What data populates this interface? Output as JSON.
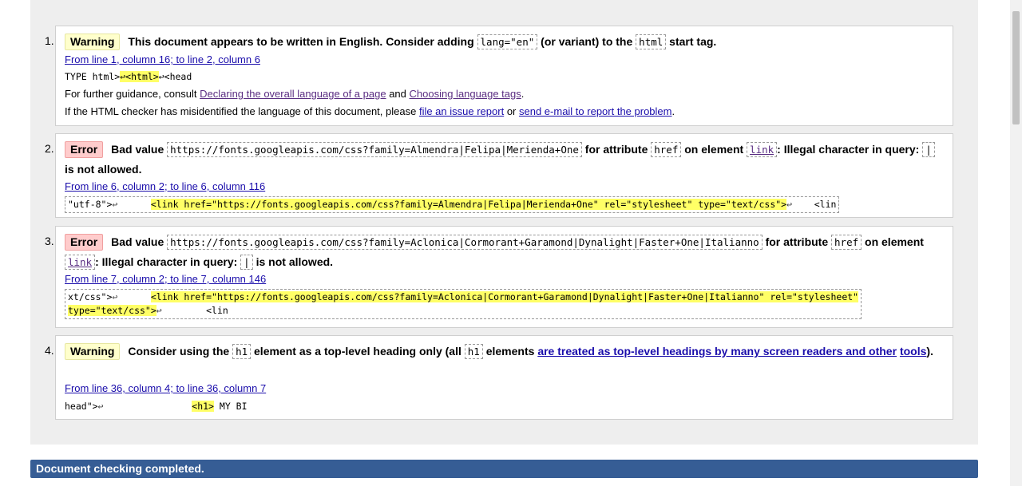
{
  "messages": [
    {
      "num": "1.",
      "type": "Warning",
      "parts": [
        "This document appears to be written in English. Consider adding",
        "lang=\"en\"",
        "(or variant) to the",
        "html",
        "start tag."
      ],
      "location": "From line 1, column 16; to line 2, column 6",
      "extract": [
        "TYPE html>",
        "↩<html>",
        "↩<head"
      ],
      "guidance": {
        "prefix": "For further guidance, consult",
        "link1": "Declaring the overall language of a page",
        "and": "and",
        "link2": "Choosing language tags",
        "end": "."
      },
      "misid": {
        "prefix": "If the HTML checker has misidentified the language of this document, please",
        "link1": "file an issue report",
        "or": "or",
        "link2": "send e-mail to report the problem",
        "end": "."
      }
    },
    {
      "num": "2.",
      "type": "Error",
      "bad_value": "Bad value",
      "url": "https://fonts.googleapis.com/css?family=Almendra|Felipa|Merienda+One",
      "for_attr": "for attribute",
      "attr": "href",
      "on_el": "on element",
      "el": "link",
      "illegal": ": Illegal character in query:",
      "char": "|",
      "not_allowed": "is not allowed.",
      "location": "From line 6, column 2; to line 6, column 116",
      "extract_pre": "\"utf-8\">",
      "extract_hl": "<link href=\"https://fonts.googleapis.com/css?family=Almendra|Felipa|Merienda+One\" rel=\"stylesheet\" type=\"text/css\">",
      "extract_post": "    <lin"
    },
    {
      "num": "3.",
      "type": "Error",
      "bad_value": "Bad value",
      "url": "https://fonts.googleapis.com/css?family=Aclonica|Cormorant+Garamond|Dynalight|Faster+One|Italianno",
      "for_attr": "for attribute",
      "attr": "href",
      "on": "on",
      "element": "element",
      "el": "link",
      "illegal": ": Illegal character in query:",
      "char": "|",
      "not_allowed": "is not allowed.",
      "location": "From line 7, column 2; to line 7, column 146",
      "extract_pre": "xt/css\">",
      "extract_hl1": "<link href=\"https://fonts.googleapis.com/css?family=Aclonica|Cormorant+Garamond|Dynalight|Faster+One|Italianno\" rel=\"stylesheet\"",
      "extract_hl2": "type=\"text/css\">",
      "extract_post": "        <lin"
    },
    {
      "num": "4.",
      "type": "Warning",
      "t1": "Consider using the",
      "h1a": "h1",
      "t2": "element as a top-level heading only (all",
      "h1b": "h1",
      "t3": "elements",
      "link": "are treated as top-level headings by many screen readers and other",
      "link2": "tools",
      "end": ").",
      "location": "From line 36, column 4; to line 36, column 7",
      "extract_pre": "head\">",
      "extract_hl": "<h1>",
      "extract_post": " MY BI"
    }
  ],
  "status": "Document checking completed."
}
